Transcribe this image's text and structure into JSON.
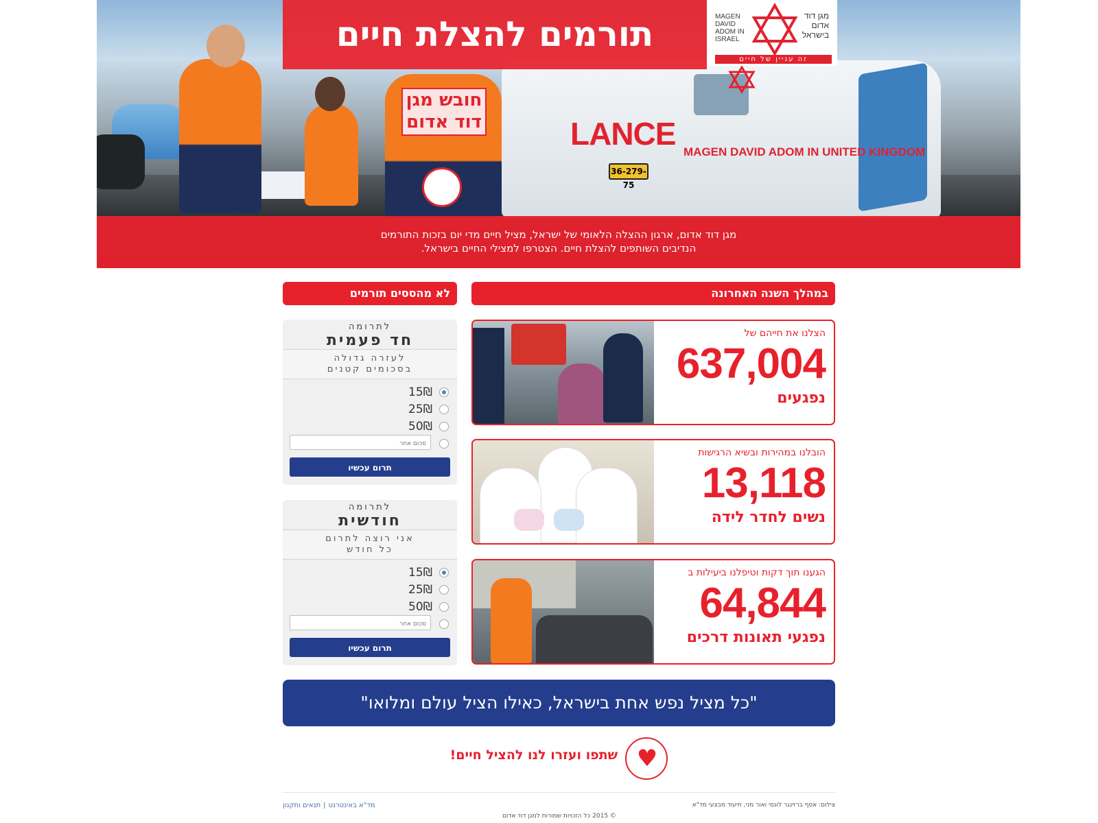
{
  "hero": {
    "title": "תורמים להצלת חיים",
    "subtitle_line1": "מגן דוד אדום, ארגון ההצלה הלאומי של ישראל, מציל חיים מדי יום בזכות התורמים",
    "subtitle_line2": "הנדיבים השותפים להצלת חיים. הצטרפו למצילי החיים בישראל.",
    "photo_text_ambulance": "LANCE",
    "photo_text_mda_uk": "MAGEN DAVID ADOM IN UNITED KINGDOM",
    "photo_text_vest": "חובש מגן דוד אדום",
    "photo_text_plate": "36-279-75"
  },
  "logo": {
    "hebrew": "מגן דוד אדום בישראל",
    "english": "MAGEN DAVID ADOM IN ISRAEL",
    "tagline": "זה עניין של חיים"
  },
  "sections": {
    "stats_header": "במהלך השנה האחרונה",
    "donate_header": "לא מהססים תורמים"
  },
  "stats": [
    {
      "caption": "הצלנו את חייהם של",
      "number": "637,004",
      "label": "נפגעים"
    },
    {
      "caption": "הובלנו במהירות ובשיא הרגישות",
      "number": "13,118",
      "label": "נשים לחדר לידה"
    },
    {
      "caption": "הגענו תוך דקות וטיפלנו ביעילות ב",
      "number": "64,844",
      "label": "נפגעי תאונות דרכים"
    }
  ],
  "donation_one_time": {
    "small": "לתרומה",
    "big": "חד פעמית",
    "sub_line1": "לעזרה גדולה",
    "sub_line2": "בסכומים קטנים",
    "options": [
      "15₪",
      "25₪",
      "50₪"
    ],
    "selected": "15₪",
    "other_placeholder": "סכום אחר",
    "button": "תרום עכשיו"
  },
  "donation_monthly": {
    "small": "לתרומה",
    "big": "חודשית",
    "sub_line1": "אני רוצה לתרום",
    "sub_line2": "כל חודש",
    "options": [
      "15₪",
      "25₪",
      "50₪"
    ],
    "selected": "15₪",
    "other_placeholder": "סכום אחר",
    "button": "תרום עכשיו"
  },
  "quote": "\"כל מציל נפש אחת בישראל, כאילו הציל עולם ומלואו\"",
  "cta": "שתפו ועזרו לנו להציל חיים!",
  "footer": {
    "link_internet": "מד\"א באינטרנט",
    "link_terms": "תנאים ותקנון",
    "credit": "צילום: אסף ברזינגר לוגסי ואור מני, תיעוד מבצעי מד\"א",
    "copyright": "© 2015 כל הזכויות שמורות למגן דוד אדום"
  },
  "colors": {
    "brand_red": "#e7212c",
    "brand_blue": "#243d8c"
  }
}
